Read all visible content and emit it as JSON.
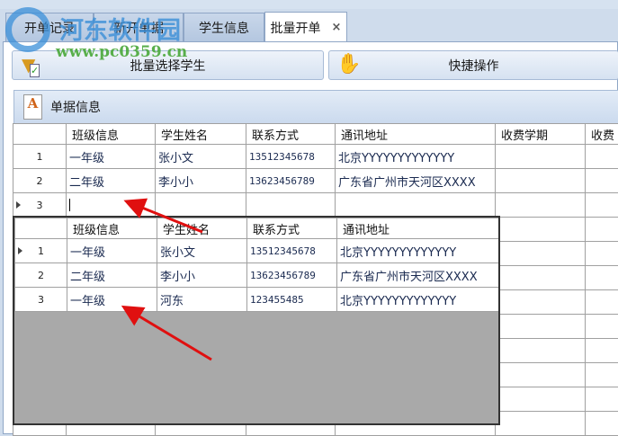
{
  "tabs": [
    {
      "label": "开单记录"
    },
    {
      "label": "新开单据"
    },
    {
      "label": "学生信息"
    },
    {
      "label": "批量开单",
      "close": "×"
    }
  ],
  "toolbar": {
    "batch_select": "批量选择学生",
    "quick_ops": "快捷操作"
  },
  "panel": {
    "title": "单据信息",
    "icon_letter": "A"
  },
  "main_grid": {
    "headers": [
      "班级信息",
      "学生姓名",
      "联系方式",
      "通讯地址",
      "收费学期",
      "收费"
    ],
    "rows": [
      {
        "n": "1",
        "cls": "一年级",
        "name": "张小文",
        "phone": "13512345678",
        "addr": "北京YYYYYYYYYYYYY"
      },
      {
        "n": "2",
        "cls": "二年级",
        "name": "李小小",
        "phone": "13623456789",
        "addr": "广东省广州市天河区XXXX"
      },
      {
        "n": "3",
        "cls": "",
        "name": "",
        "phone": "",
        "addr": ""
      }
    ]
  },
  "popup_grid": {
    "headers": [
      "班级信息",
      "学生姓名",
      "联系方式",
      "通讯地址"
    ],
    "rows": [
      {
        "n": "1",
        "cls": "一年级",
        "name": "张小文",
        "phone": "13512345678",
        "addr": "北京YYYYYYYYYYYYY"
      },
      {
        "n": "2",
        "cls": "二年级",
        "name": "李小小",
        "phone": "13623456789",
        "addr": "广东省广州市天河区XXXX"
      },
      {
        "n": "3",
        "cls": "一年级",
        "name": "河东",
        "phone": "123455485",
        "addr": "北京YYYYYYYYYYYYY"
      }
    ]
  },
  "watermark": {
    "name": "河东软件园",
    "url": "www.pc0359.cn"
  }
}
